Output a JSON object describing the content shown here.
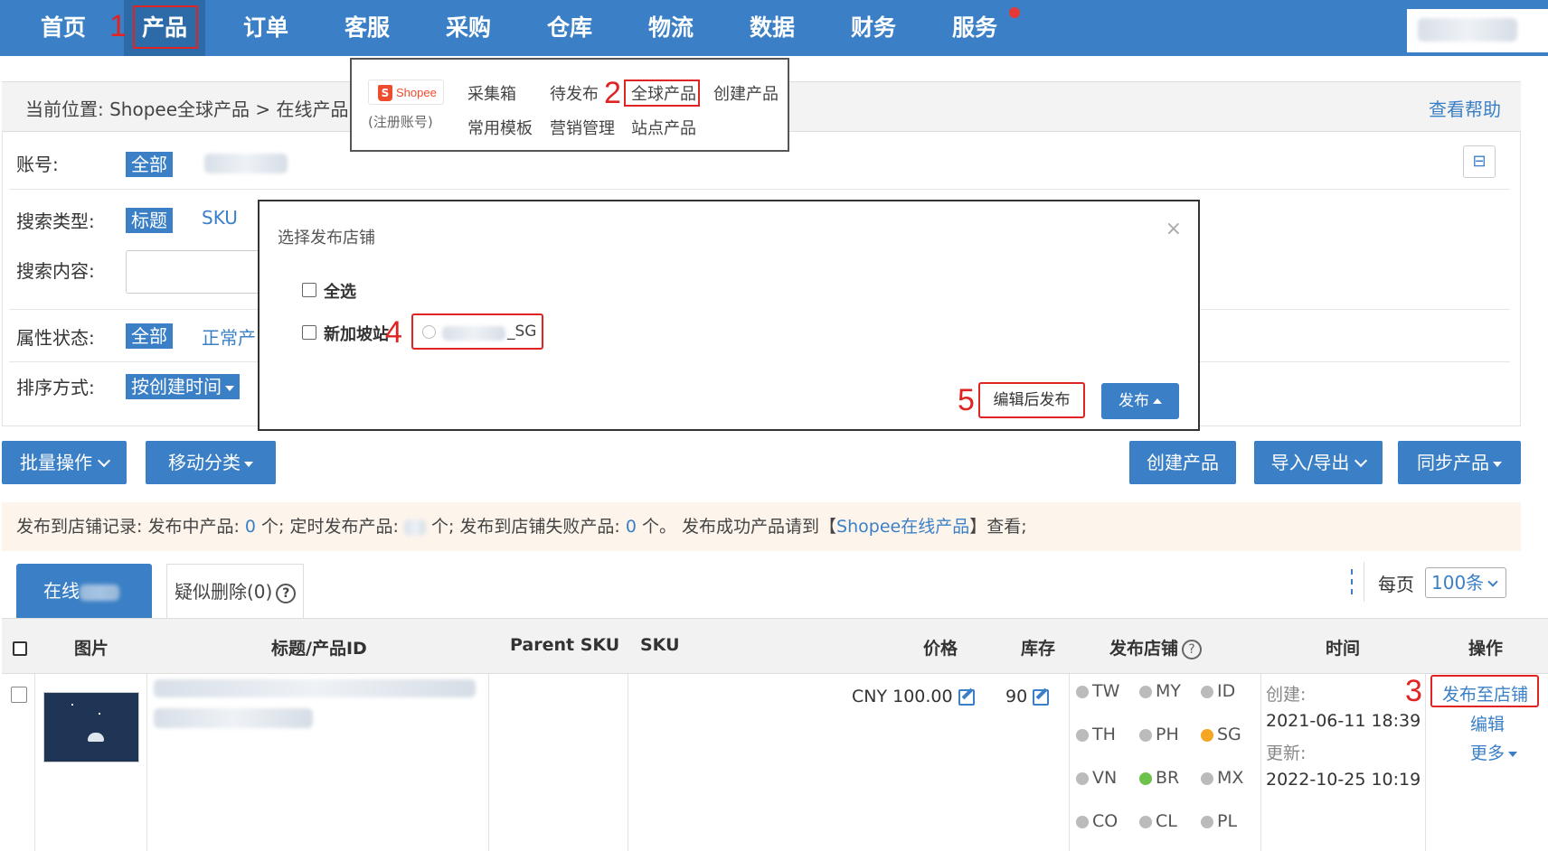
{
  "nav": {
    "items": [
      "首页",
      "产品",
      "订单",
      "客服",
      "采购",
      "仓库",
      "物流",
      "数据",
      "财务",
      "服务"
    ]
  },
  "annotations": {
    "n1": "1",
    "n2": "2",
    "n3": "3",
    "n4": "4",
    "n5": "5"
  },
  "location": {
    "text": "当前位置: Shopee全球产品 > 在线产品",
    "help": "查看帮助"
  },
  "dropdown": {
    "shopee_word": "Shopee",
    "register": "(注册账号)",
    "items": [
      "采集箱",
      "待发布",
      "全球产品",
      "创建产品",
      "常用模板",
      "营销管理",
      "站点产品"
    ]
  },
  "filters": {
    "account_label": "账号:",
    "account_all": "全部",
    "search_type_label": "搜索类型:",
    "search_type_title": "标题",
    "search_type_sku": "SKU",
    "search_content_label": "搜索内容:",
    "attr_label": "属性状态:",
    "attr_all": "全部",
    "attr_normal": "正常产",
    "sort_label": "排序方式:",
    "sort_value": "按创建时间"
  },
  "modal": {
    "title": "选择发布店铺",
    "close": "×",
    "select_all": "全选",
    "site": "新加坡站",
    "shop_suffix": "_SG",
    "edit_publish": "编辑后发布",
    "publish": "发布"
  },
  "actions": {
    "batch": "批量操作",
    "move": "移动分类",
    "create": "创建产品",
    "import_export": "导入/导出",
    "sync": "同步产品"
  },
  "notice": {
    "p1": "发布到店铺记录:  发布中产品: ",
    "c1": "0",
    "p2": " 个;  定时发布产品: ",
    "p3": " 个;  发布到店铺失败产品: ",
    "c3": "0",
    "p4": " 个。 发布成功产品请到【",
    "link": "Shopee在线产品",
    "p5": "】查看;"
  },
  "tabs": {
    "online": "在线",
    "suspect": "疑似删除(0)",
    "help": "?"
  },
  "pagination": {
    "label": "每页",
    "value": "100条"
  },
  "table": {
    "headers": [
      "图片",
      "标题/产品ID",
      "Parent SKU",
      "SKU",
      "价格",
      "库存",
      "发布店铺",
      "时间",
      "操作"
    ],
    "row": {
      "price": "CNY  100.00",
      "stock": "90",
      "created_label": "创建:",
      "created": "2021-06-11 18:39",
      "updated_label": "更新:",
      "updated": "2022-10-25 10:19",
      "op_publish": "发布至店铺",
      "op_edit": "编辑",
      "op_more": "更多"
    },
    "stores": [
      {
        "code": "TW",
        "color": "#bbbbbb"
      },
      {
        "code": "MY",
        "color": "#bbbbbb"
      },
      {
        "code": "ID",
        "color": "#bbbbbb"
      },
      {
        "code": "TH",
        "color": "#bbbbbb"
      },
      {
        "code": "PH",
        "color": "#bbbbbb"
      },
      {
        "code": "SG",
        "color": "#f5a623"
      },
      {
        "code": "VN",
        "color": "#bbbbbb"
      },
      {
        "code": "BR",
        "color": "#6cc24a"
      },
      {
        "code": "MX",
        "color": "#bbbbbb"
      },
      {
        "code": "CO",
        "color": "#bbbbbb"
      },
      {
        "code": "CL",
        "color": "#bbbbbb"
      },
      {
        "code": "PL",
        "color": "#bbbbbb"
      }
    ]
  }
}
